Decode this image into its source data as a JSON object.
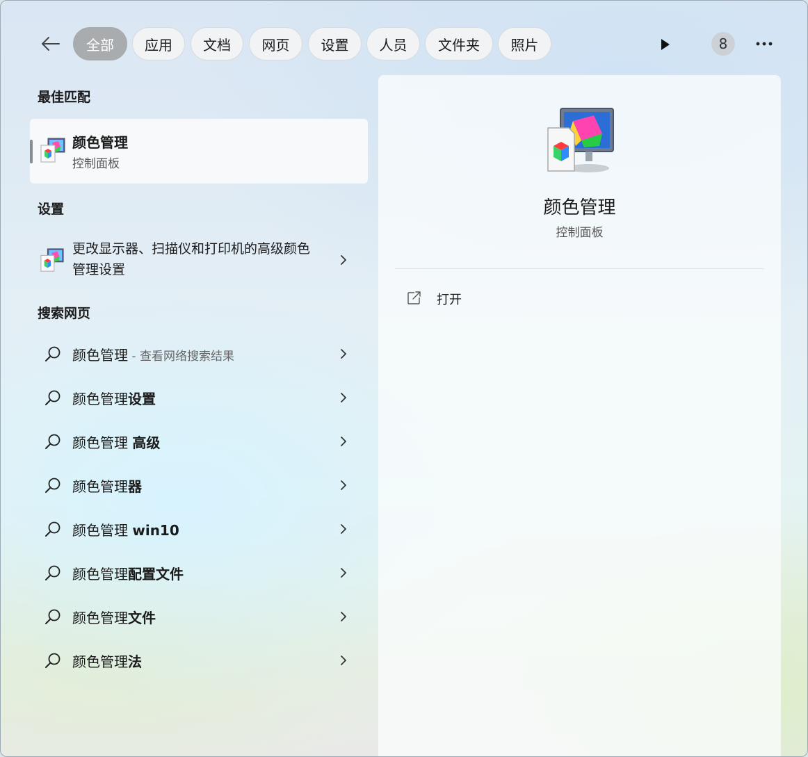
{
  "filters": {
    "tabs": [
      {
        "label": "全部",
        "active": true
      },
      {
        "label": "应用"
      },
      {
        "label": "文档"
      },
      {
        "label": "网页"
      },
      {
        "label": "设置"
      },
      {
        "label": "人员"
      },
      {
        "label": "文件夹"
      },
      {
        "label": "照片"
      }
    ],
    "badge": "8"
  },
  "best_match": {
    "heading": "最佳匹配",
    "title": "颜色管理",
    "subtitle": "控制面板",
    "icon": "color-management-icon"
  },
  "settings": {
    "heading": "设置",
    "item_text": "更改显示器、扫描仪和打印机的高级颜色管理设置",
    "icon": "color-management-icon"
  },
  "web": {
    "heading": "搜索网页",
    "items": [
      {
        "base": "颜色管理",
        "suffix": "",
        "hint": " - 查看网络搜索结果"
      },
      {
        "base": "颜色管理",
        "suffix": "设置",
        "hint": ""
      },
      {
        "base": "颜色管理 ",
        "suffix": "高级",
        "hint": ""
      },
      {
        "base": "颜色管理",
        "suffix": "器",
        "hint": ""
      },
      {
        "base": "颜色管理 ",
        "suffix": "win10",
        "hint": ""
      },
      {
        "base": "颜色管理",
        "suffix": "配置文件",
        "hint": ""
      },
      {
        "base": "颜色管理",
        "suffix": "文件",
        "hint": ""
      },
      {
        "base": "颜色管理",
        "suffix": "法",
        "hint": ""
      }
    ]
  },
  "preview": {
    "title": "颜色管理",
    "subtitle": "控制面板",
    "actions": [
      {
        "label": "打开",
        "icon": "open-external-icon"
      }
    ]
  }
}
